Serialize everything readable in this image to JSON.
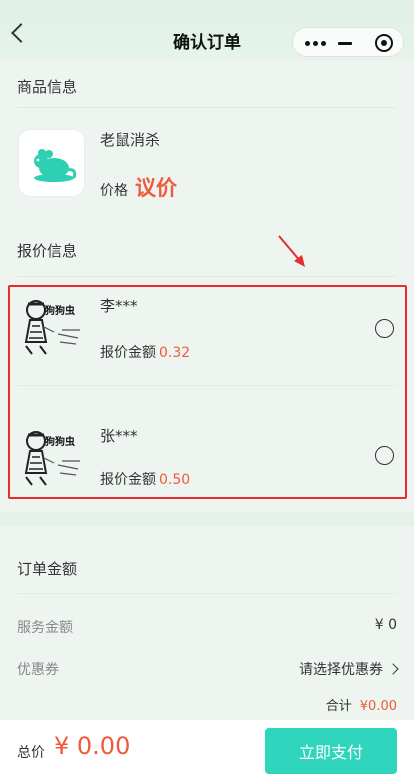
{
  "nav": {
    "title": "确认订单"
  },
  "product_section": {
    "label": "商品信息",
    "name": "老鼠消杀",
    "price_label": "价格",
    "price_value": "议价"
  },
  "quote_section": {
    "label": "报价信息",
    "items": [
      {
        "name": "李***",
        "amount_label": "报价金额",
        "amount": "0.32",
        "avatar_text": "狗狗虫"
      },
      {
        "name": "张***",
        "amount_label": "报价金额",
        "amount": "0.50",
        "avatar_text": "狗狗虫"
      }
    ]
  },
  "order_section": {
    "label": "订单金额",
    "service_label": "服务金额",
    "service_value": "¥ 0",
    "coupon_label": "优惠券",
    "coupon_value": "请选择优惠券",
    "subtotal_label": "合计",
    "subtotal_value": "¥0.00"
  },
  "footer": {
    "total_label": "总价",
    "total_value": "¥ 0.00",
    "pay_label": "立即支付"
  },
  "colors": {
    "accent": "#2fd5bd",
    "price": "#f05a3a",
    "highlight": "#e62e2e"
  }
}
